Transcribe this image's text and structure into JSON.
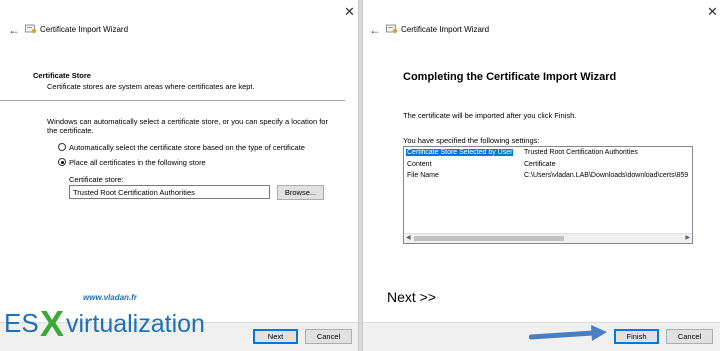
{
  "left": {
    "close": "✕",
    "back": "←",
    "title": "Certificate Import Wizard",
    "section_title": "Certificate Store",
    "section_desc": "Certificate stores are system areas where certificates are kept.",
    "intro_line1": "Windows can automatically select a certificate store, or you can specify a location for",
    "intro_line2": "the certificate.",
    "radio_auto": "Automatically select the certificate store based on the type of certificate",
    "radio_place": "Place all certificates in the following store",
    "store_label": "Certificate store:",
    "store_value": "Trusted Root Certification Authorities",
    "browse": "Browse...",
    "next": "Next",
    "cancel": "Cancel"
  },
  "right": {
    "close": "✕",
    "back": "←",
    "title": "Certificate Import Wizard",
    "heading": "Completing the Certificate Import Wizard",
    "desc": "The certificate will be imported after you click Finish.",
    "settings_label": "You have specified the following settings:",
    "settings": [
      {
        "key": "Certificate Store Selected by User",
        "value": "Trusted Root Certification Authorities"
      },
      {
        "key": "Content",
        "value": "Certificate"
      },
      {
        "key": "File Name",
        "value": "C:\\Users\\vladan.LAB\\Downloads\\download\\certs\\859"
      }
    ],
    "scroll_left": "◀",
    "scroll_right": "▶",
    "overlay_text": "Next >>",
    "finish": "Finish",
    "cancel": "Cancel"
  },
  "watermark": {
    "site": "www.vladan.fr",
    "brand_es": "ES",
    "brand_x": "X",
    "brand_rest": "virtualization"
  },
  "colors": {
    "accent": "#0078d7",
    "arrow": "#4a7fc4",
    "logo_blue": "#1f6fb5",
    "logo_green": "#3aa935"
  }
}
